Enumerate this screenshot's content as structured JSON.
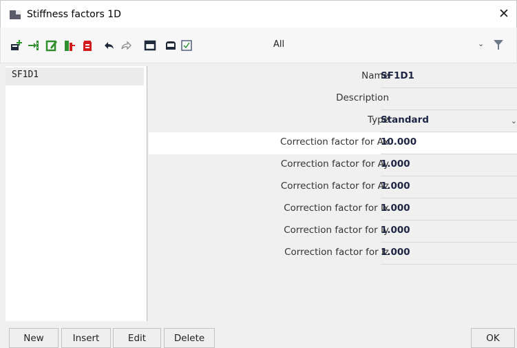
{
  "window": {
    "title": "Stiffness factors 1D",
    "close_glyph": "✕"
  },
  "toolbar": {
    "filter_value": "All",
    "filter_dropdown_glyph": "⌄",
    "icons": [
      "new-record-icon",
      "insert-icon",
      "edit-icon",
      "copy-icon",
      "delete-icon",
      "undo-icon",
      "redo-icon",
      "window-icon",
      "print-icon",
      "checkbox-icon",
      "filter-icon"
    ]
  },
  "list": {
    "items": [
      {
        "label": "SF1D1"
      }
    ]
  },
  "properties": [
    {
      "label": "Name",
      "value": "SF1D1"
    },
    {
      "label": "Description",
      "value": ""
    },
    {
      "label": "Type",
      "value": "Standard"
    },
    {
      "label": "Correction factor for Ax",
      "value": "10.000"
    },
    {
      "label": "Correction factor for Ay",
      "value": "1.000"
    },
    {
      "label": "Correction factor for Az",
      "value": "1.000"
    },
    {
      "label": "Correction factor for Ix",
      "value": "1.000"
    },
    {
      "label": "Correction factor for Iy",
      "value": "1.000"
    },
    {
      "label": "Correction factor for Iz",
      "value": "1.000"
    }
  ],
  "buttons": {
    "new": "New",
    "insert": "Insert",
    "edit": "Edit",
    "delete": "Delete",
    "ok": "OK"
  },
  "colors": {
    "accent_green": "#2f8f2f",
    "delete_red": "#d21c1c",
    "icon_dark": "#1e2a3a",
    "value_text": "#1c2542"
  }
}
